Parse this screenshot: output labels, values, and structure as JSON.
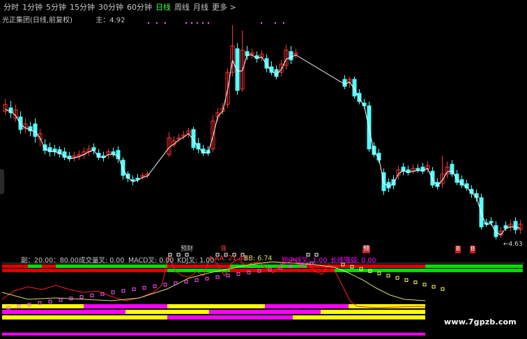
{
  "toolbar": {
    "tabs": [
      {
        "label": "分时",
        "active": false
      },
      {
        "label": "1分钟",
        "active": false
      },
      {
        "label": "5分钟",
        "active": false
      },
      {
        "label": "15分钟",
        "active": false
      },
      {
        "label": "30分钟",
        "active": false
      },
      {
        "label": "60分钟",
        "active": false
      },
      {
        "label": "日线",
        "active": true
      },
      {
        "label": "周线",
        "active": false
      },
      {
        "label": "月线",
        "active": false
      }
    ],
    "more_label": "更多 >"
  },
  "stock": {
    "name": "光正集团(日线,前复权)",
    "indicator": "主：4.92"
  },
  "price_label_low": "←4.63",
  "event_tags": {
    "fin_a": "预财",
    "rise": "涨",
    "fin_b": "预",
    "b1": "B",
    "b2": "B"
  },
  "indicator_row": {
    "sub": "副：20.00：80.00",
    "vol_cross": "成交量叉: 0.00",
    "macd_cross": "MACD叉: 0.00",
    "kdj_cross": "KDJ叉: 1.00",
    "aa": "AA: 21.48",
    "bb": "BB: 6.74",
    "mid_cross": "短中线叉: 1.00",
    "long_strength": "长线强弱: 0.00"
  },
  "watermark": "www.7gpzb.com",
  "colors": {
    "up": "#ff3232",
    "down": "#54ffff",
    "ma": "#ffffff",
    "bar_green": "#00dd00",
    "bar_red": "#dd0000",
    "bar_yellow": "#ffff00",
    "bar_magenta": "#ff00ff",
    "line_red": "#ff2020",
    "line_yellow": "#dddd66"
  }
}
